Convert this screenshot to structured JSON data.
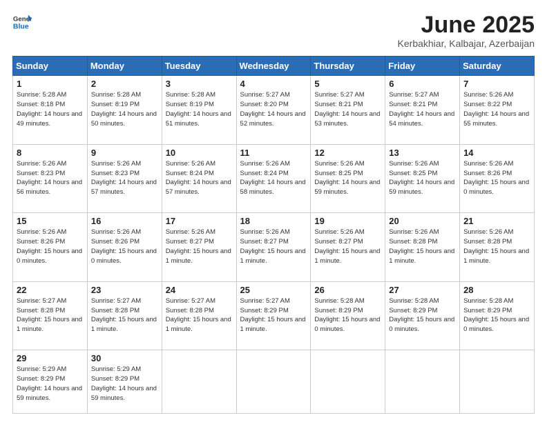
{
  "logo": {
    "line1": "General",
    "line2": "Blue"
  },
  "title": "June 2025",
  "location": "Kerbakhiar, Kalbajar, Azerbaijan",
  "days_of_week": [
    "Sunday",
    "Monday",
    "Tuesday",
    "Wednesday",
    "Thursday",
    "Friday",
    "Saturday"
  ],
  "weeks": [
    [
      {
        "num": "1",
        "sunrise": "5:28 AM",
        "sunset": "8:18 PM",
        "daylight": "14 hours and 49 minutes."
      },
      {
        "num": "2",
        "sunrise": "5:28 AM",
        "sunset": "8:19 PM",
        "daylight": "14 hours and 50 minutes."
      },
      {
        "num": "3",
        "sunrise": "5:28 AM",
        "sunset": "8:19 PM",
        "daylight": "14 hours and 51 minutes."
      },
      {
        "num": "4",
        "sunrise": "5:27 AM",
        "sunset": "8:20 PM",
        "daylight": "14 hours and 52 minutes."
      },
      {
        "num": "5",
        "sunrise": "5:27 AM",
        "sunset": "8:21 PM",
        "daylight": "14 hours and 53 minutes."
      },
      {
        "num": "6",
        "sunrise": "5:27 AM",
        "sunset": "8:21 PM",
        "daylight": "14 hours and 54 minutes."
      },
      {
        "num": "7",
        "sunrise": "5:26 AM",
        "sunset": "8:22 PM",
        "daylight": "14 hours and 55 minutes."
      }
    ],
    [
      {
        "num": "8",
        "sunrise": "5:26 AM",
        "sunset": "8:23 PM",
        "daylight": "14 hours and 56 minutes."
      },
      {
        "num": "9",
        "sunrise": "5:26 AM",
        "sunset": "8:23 PM",
        "daylight": "14 hours and 57 minutes."
      },
      {
        "num": "10",
        "sunrise": "5:26 AM",
        "sunset": "8:24 PM",
        "daylight": "14 hours and 57 minutes."
      },
      {
        "num": "11",
        "sunrise": "5:26 AM",
        "sunset": "8:24 PM",
        "daylight": "14 hours and 58 minutes."
      },
      {
        "num": "12",
        "sunrise": "5:26 AM",
        "sunset": "8:25 PM",
        "daylight": "14 hours and 59 minutes."
      },
      {
        "num": "13",
        "sunrise": "5:26 AM",
        "sunset": "8:25 PM",
        "daylight": "14 hours and 59 minutes."
      },
      {
        "num": "14",
        "sunrise": "5:26 AM",
        "sunset": "8:26 PM",
        "daylight": "15 hours and 0 minutes."
      }
    ],
    [
      {
        "num": "15",
        "sunrise": "5:26 AM",
        "sunset": "8:26 PM",
        "daylight": "15 hours and 0 minutes."
      },
      {
        "num": "16",
        "sunrise": "5:26 AM",
        "sunset": "8:26 PM",
        "daylight": "15 hours and 0 minutes."
      },
      {
        "num": "17",
        "sunrise": "5:26 AM",
        "sunset": "8:27 PM",
        "daylight": "15 hours and 1 minute."
      },
      {
        "num": "18",
        "sunrise": "5:26 AM",
        "sunset": "8:27 PM",
        "daylight": "15 hours and 1 minute."
      },
      {
        "num": "19",
        "sunrise": "5:26 AM",
        "sunset": "8:27 PM",
        "daylight": "15 hours and 1 minute."
      },
      {
        "num": "20",
        "sunrise": "5:26 AM",
        "sunset": "8:28 PM",
        "daylight": "15 hours and 1 minute."
      },
      {
        "num": "21",
        "sunrise": "5:26 AM",
        "sunset": "8:28 PM",
        "daylight": "15 hours and 1 minute."
      }
    ],
    [
      {
        "num": "22",
        "sunrise": "5:27 AM",
        "sunset": "8:28 PM",
        "daylight": "15 hours and 1 minute."
      },
      {
        "num": "23",
        "sunrise": "5:27 AM",
        "sunset": "8:28 PM",
        "daylight": "15 hours and 1 minute."
      },
      {
        "num": "24",
        "sunrise": "5:27 AM",
        "sunset": "8:28 PM",
        "daylight": "15 hours and 1 minute."
      },
      {
        "num": "25",
        "sunrise": "5:27 AM",
        "sunset": "8:29 PM",
        "daylight": "15 hours and 1 minute."
      },
      {
        "num": "26",
        "sunrise": "5:28 AM",
        "sunset": "8:29 PM",
        "daylight": "15 hours and 0 minutes."
      },
      {
        "num": "27",
        "sunrise": "5:28 AM",
        "sunset": "8:29 PM",
        "daylight": "15 hours and 0 minutes."
      },
      {
        "num": "28",
        "sunrise": "5:28 AM",
        "sunset": "8:29 PM",
        "daylight": "15 hours and 0 minutes."
      }
    ],
    [
      {
        "num": "29",
        "sunrise": "5:29 AM",
        "sunset": "8:29 PM",
        "daylight": "14 hours and 59 minutes."
      },
      {
        "num": "30",
        "sunrise": "5:29 AM",
        "sunset": "8:29 PM",
        "daylight": "14 hours and 59 minutes."
      },
      null,
      null,
      null,
      null,
      null
    ]
  ]
}
